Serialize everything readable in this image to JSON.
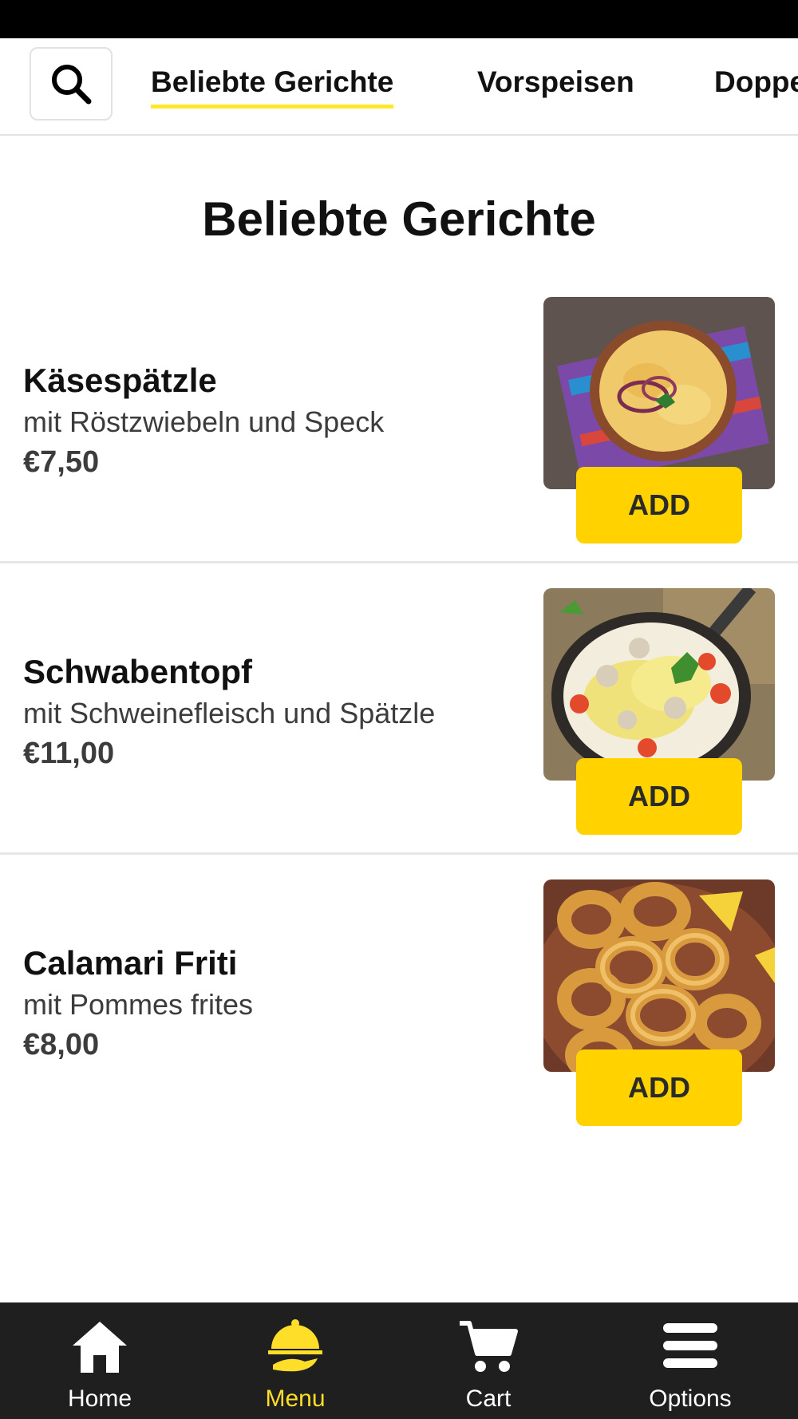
{
  "tabs": [
    {
      "label": "Beliebte Gerichte"
    },
    {
      "label": "Vorspeisen"
    },
    {
      "label": "Doppe"
    }
  ],
  "section_title": "Beliebte Gerichte",
  "items": [
    {
      "name": "Käsespätzle",
      "desc": "mit Röstzwiebeln und Speck",
      "price": "€7,50",
      "add": "ADD"
    },
    {
      "name": "Schwabentopf",
      "desc": "mit Schweinefleisch und Spätzle",
      "price": "€11,00",
      "add": "ADD"
    },
    {
      "name": "Calamari Friti",
      "desc": "mit Pommes frites",
      "price": "€8,00",
      "add": "ADD"
    }
  ],
  "nav": [
    {
      "label": "Home",
      "icon": "home-icon"
    },
    {
      "label": "Menu",
      "icon": "menu-cloche-icon"
    },
    {
      "label": "Cart",
      "icon": "cart-icon"
    },
    {
      "label": "Options",
      "icon": "hamburger-icon"
    }
  ],
  "colors": {
    "accent": "#ffd200",
    "active_nav": "#ffde2a",
    "nav_bg": "#1f1f1f"
  }
}
